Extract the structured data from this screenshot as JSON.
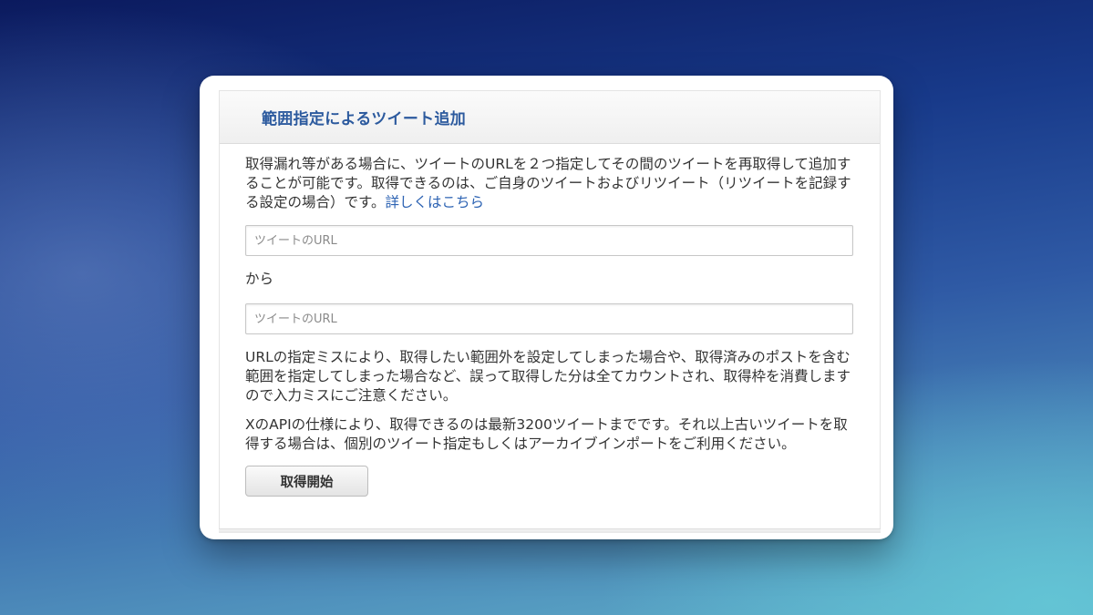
{
  "panel": {
    "title": "範囲指定によるツイート追加",
    "intro_text": "取得漏れ等がある場合に、ツイートのURLを２つ指定してその間のツイートを再取得して追加することが可能です。取得できるのは、ご自身のツイートおよびリツイート（リツイートを記録する設定の場合）です。",
    "intro_link": "詳しくはこちら",
    "start_url_placeholder": "ツイートのURL",
    "start_url_value": "",
    "from_label": "から",
    "end_url_placeholder": "ツイートのURL",
    "end_url_value": "",
    "warning_text": "URLの指定ミスにより、取得したい範囲外を設定してしまった場合や、取得済みのポストを含む範囲を指定してしまった場合など、誤って取得した分は全てカウントされ、取得枠を消費しますので入力ミスにご注意ください。",
    "api_note_text": "XのAPIの仕様により、取得できるのは最新3200ツイートまでです。それ以上古いツイートを取得する場合は、個別のツイート指定もしくはアーカイブインポートをご利用ください。",
    "start_button_label": "取得開始"
  },
  "colors": {
    "title": "#2c5a9e",
    "link": "#2d63b3",
    "text": "#333333"
  }
}
